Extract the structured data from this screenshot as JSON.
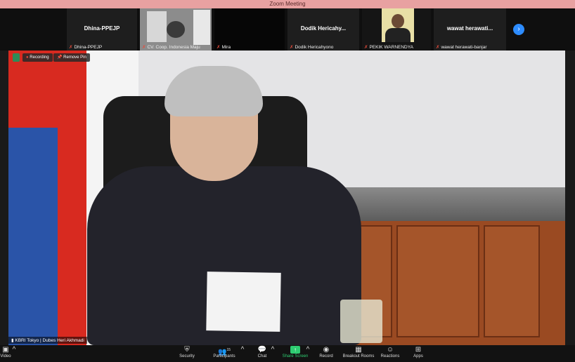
{
  "window": {
    "title": "Zoom Meeting"
  },
  "participants_strip": [
    {
      "display_name": "Dhina-PPEJP",
      "caption": "Dhina-PPEJP",
      "video": false
    },
    {
      "display_name": "",
      "caption": "CV. Coop. Indonesia Maju",
      "video": true
    },
    {
      "display_name": "",
      "caption": "Mira",
      "video": false
    },
    {
      "display_name": "Dodik  Hericahy...",
      "caption": "Dodik Hericahyono",
      "video": false
    },
    {
      "display_name": "",
      "caption": "PEKIK WARNENDYA",
      "video": true
    },
    {
      "display_name": "wawat  herawati...",
      "caption": "wawat herawati-banjar",
      "video": false
    }
  ],
  "main_video": {
    "speaker_label": "KBRI Tokyo | Dubes Heri Akhmadi",
    "recording_label": "Recording",
    "remove_pin_label": "Remove Pin"
  },
  "toolbar": {
    "video": "Video",
    "security": "Security",
    "participants": "Participants",
    "participants_count": "15",
    "chat": "Chat",
    "share_screen": "Share Screen",
    "record": "Record",
    "breakout_rooms": "Breakout Rooms",
    "reactions": "Reactions",
    "apps": "Apps"
  },
  "colors": {
    "accent": "#2d8cff",
    "share": "#2ecc71",
    "muted": "#e74c3c"
  }
}
